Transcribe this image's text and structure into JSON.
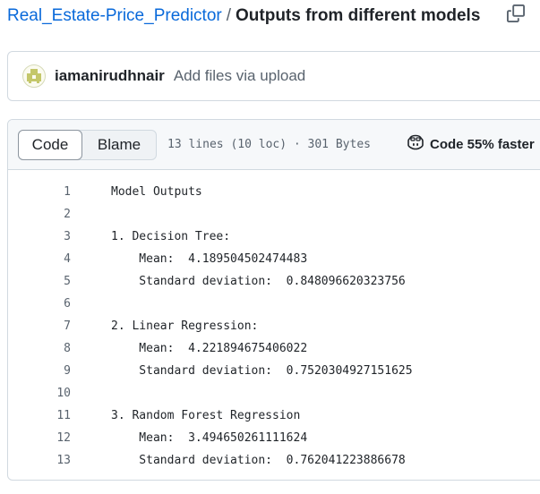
{
  "breadcrumb": {
    "repo": "Real_Estate-Price_Predictor",
    "separator": "/",
    "file": "Outputs from different models"
  },
  "copy_icon": "copy-icon",
  "commit": {
    "avatar_icon": "user-avatar",
    "username": "iamanirudhnair",
    "message": "Add files via upload"
  },
  "file_header": {
    "code_tab": "Code",
    "blame_tab": "Blame",
    "meta": "13 lines (10 loc) · 301 Bytes",
    "copilot_icon": "copilot-icon",
    "copilot_text": "Code 55% faster"
  },
  "lines": [
    {
      "n": "1",
      "text": "Model Outputs"
    },
    {
      "n": "2",
      "text": ""
    },
    {
      "n": "3",
      "text": "1. Decision Tree:"
    },
    {
      "n": "4",
      "text": "    Mean:  4.189504502474483"
    },
    {
      "n": "5",
      "text": "    Standard deviation:  0.848096620323756"
    },
    {
      "n": "6",
      "text": ""
    },
    {
      "n": "7",
      "text": "2. Linear Regression:"
    },
    {
      "n": "8",
      "text": "    Mean:  4.221894675406022"
    },
    {
      "n": "9",
      "text": "    Standard deviation:  0.7520304927151625"
    },
    {
      "n": "10",
      "text": ""
    },
    {
      "n": "11",
      "text": "3. Random Forest Regression"
    },
    {
      "n": "12",
      "text": "    Mean:  3.494650261111624"
    },
    {
      "n": "13",
      "text": "    Standard deviation:  0.762041223886678"
    }
  ],
  "colors": {
    "link": "#0969da",
    "muted": "#59636e",
    "border": "#d1d9e0",
    "header_bg": "#f6f8fa"
  }
}
